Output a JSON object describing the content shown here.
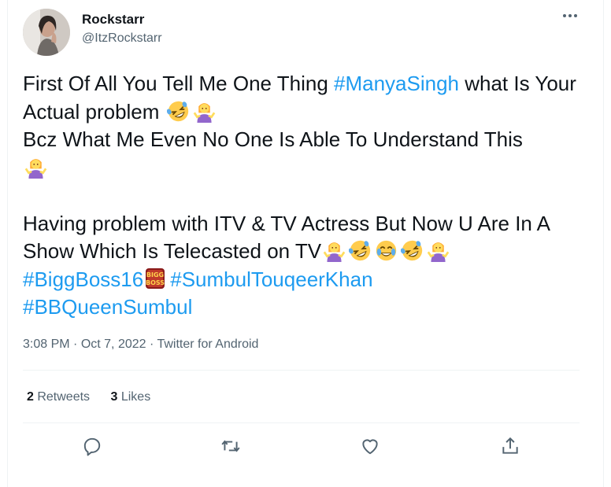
{
  "author": {
    "name": "Rockstarr",
    "handle": "@ItzRockstarr"
  },
  "tweet": {
    "line1_text": "First Of All You Tell Me One Thing ",
    "line1_tag": "#ManyaSingh",
    "line1_after": " what Is Your Actual problem ",
    "line2": "Bcz What Me Even No One Is Able To Understand This",
    "line3_text": "Having problem with ITV & TV Actress But Now U Are In A Show Which Is Telecasted on TV",
    "tag_biggboss": "#BiggBoss16",
    "tag_sumbul": "#SumbulTouqeerKhan",
    "tag_queen": "#BBQueenSumbul",
    "biggboss_icon_text_top": "BIGG",
    "biggboss_icon_text_bottom": "BOSS"
  },
  "meta": {
    "time": "3:08 PM",
    "sep1": " · ",
    "date": "Oct 7, 2022",
    "sep2": " · ",
    "source": "Twitter for Android"
  },
  "stats": {
    "retweets_count": "2",
    "retweets_label": " Retweets",
    "likes_count": "3",
    "likes_label": " Likes"
  },
  "icons": {
    "more": "more-options-icon",
    "reply": "reply-icon",
    "retweet": "retweet-icon",
    "like": "like-icon",
    "share": "share-icon",
    "emoji_laugh_roll": "rolling-on-floor-laughing-emoji",
    "emoji_shrug": "woman-shrugging-emoji",
    "emoji_joy": "face-with-tears-of-joy-emoji"
  },
  "colors": {
    "link": "#1d9bf0",
    "text": "#0f1419",
    "secondary": "#536471",
    "divider": "#eff3f4"
  }
}
